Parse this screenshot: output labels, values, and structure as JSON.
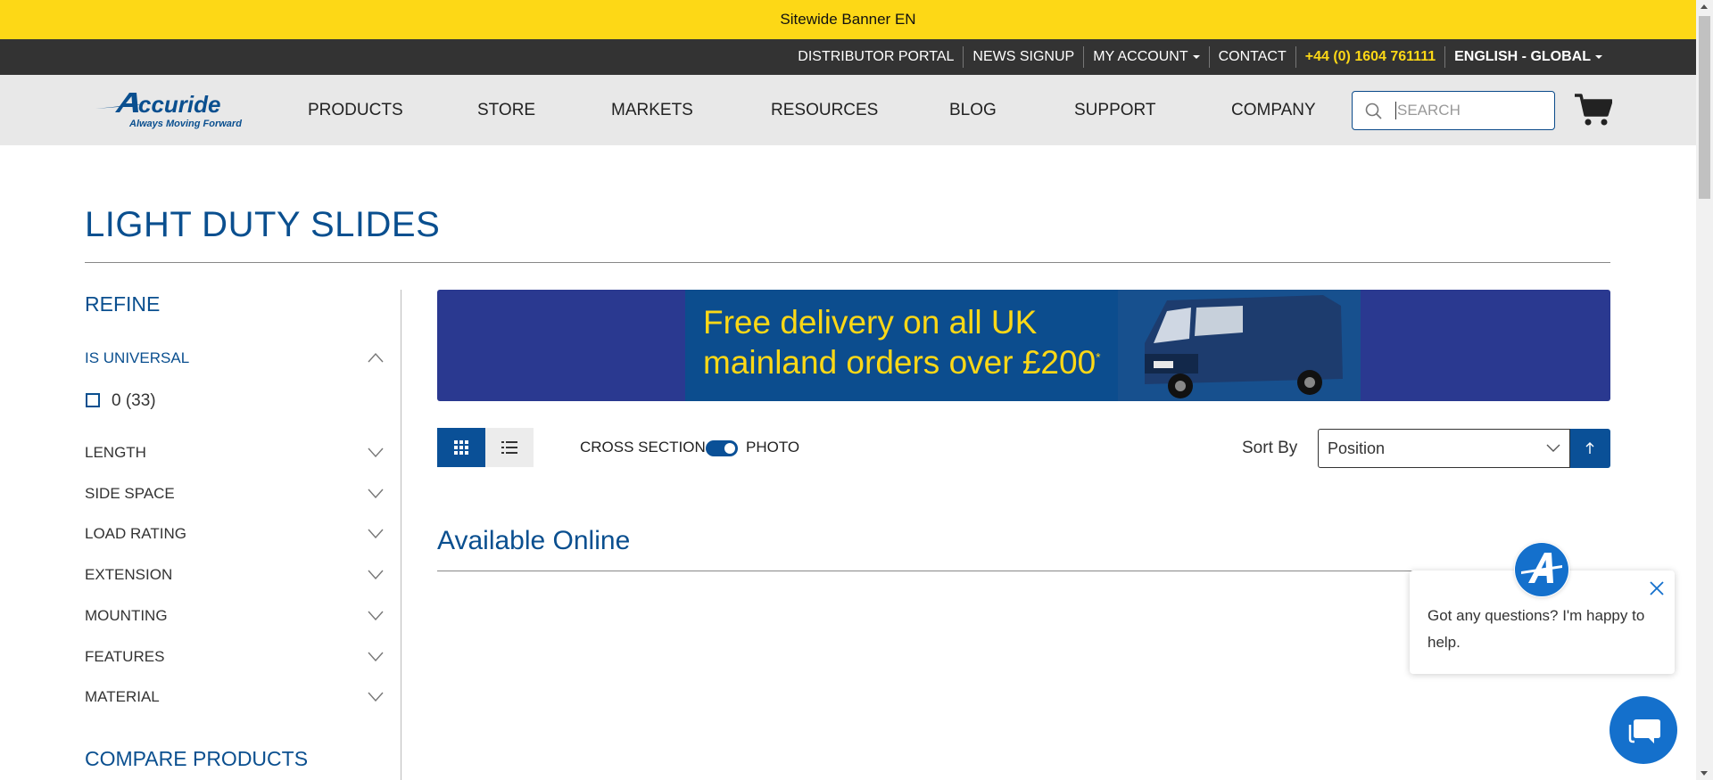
{
  "banner": {
    "text": "Sitewide Banner EN"
  },
  "topbar": {
    "distributor_portal": "DISTRIBUTOR PORTAL",
    "news_signup": "NEWS SIGNUP",
    "my_account": "MY ACCOUNT",
    "contact": "CONTACT",
    "phone": "+44 (0) 1604 761111",
    "language": "ENGLISH - GLOBAL"
  },
  "logo": {
    "name": "Accuride",
    "tagline": "Always Moving Forward"
  },
  "nav": {
    "items": [
      "PRODUCTS",
      "STORE",
      "MARKETS",
      "RESOURCES",
      "BLOG",
      "SUPPORT",
      "COMPANY"
    ]
  },
  "search": {
    "placeholder": "SEARCH"
  },
  "page": {
    "title": "LIGHT DUTY SLIDES"
  },
  "sidebar": {
    "refine": "REFINE",
    "facets": [
      "IS UNIVERSAL",
      "LENGTH",
      "SIDE SPACE",
      "LOAD RATING",
      "EXTENSION",
      "MOUNTING",
      "FEATURES",
      "MATERIAL"
    ],
    "is_universal_option": "0 (33)",
    "compare": "COMPARE PRODUCTS"
  },
  "promo": {
    "line1": "Free delivery on all UK",
    "line2": "mainland orders over £200",
    "asterisk": "*"
  },
  "toolbar": {
    "cross_section": "CROSS SECTION",
    "photo": "PHOTO",
    "sort_by": "Sort By",
    "sort_value": "Position"
  },
  "section": {
    "available_online": "Available Online"
  },
  "chat": {
    "message": "Got any questions? I'm happy to help."
  },
  "colors": {
    "brand_blue": "#0a4f8f",
    "banner_yellow": "#fdd816",
    "topbar_dark": "#333333",
    "nav_gray": "#e8e8e8"
  }
}
